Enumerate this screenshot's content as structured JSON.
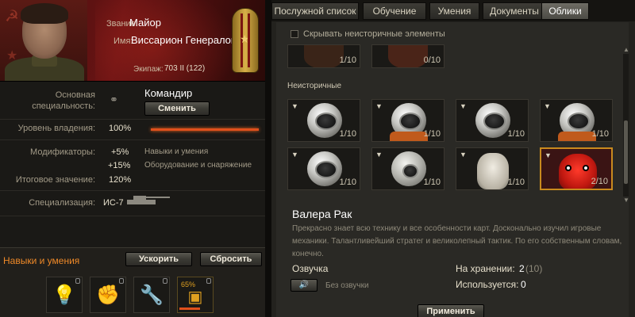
{
  "header": {
    "rank_label": "Звание:",
    "rank": "Майор",
    "name_label": "Имя:",
    "name": "Виссарион Генералов",
    "crew_label": "Экипаж:",
    "crew": "703 II (122)"
  },
  "specialty": {
    "main_label_line1": "Основная",
    "main_label_line2": "специальность:",
    "main_value": "Командир",
    "change_button": "Сменить"
  },
  "stats": {
    "mastery_label": "Уровень владения:",
    "mastery_value": "100%",
    "mastery_fill": 1.0,
    "modifiers_label": "Модификаторы:",
    "modifiers": [
      {
        "value": "+5%",
        "source": "Навыки и умения"
      },
      {
        "value": "+15%",
        "source": "Оборудование и снаряжение"
      }
    ],
    "total_label": "Итоговое значение:",
    "total_value": "120%",
    "specialization_label": "Специализация:",
    "specialization_value": "ИС-7"
  },
  "skills": {
    "title": "Навыки и умения",
    "accelerate_button": "Ускорить",
    "reset_button": "Сбросить",
    "items": [
      {
        "name": "lightbulb-icon",
        "color": "#ff7a20"
      },
      {
        "name": "fist-icon",
        "color": "#d8d2c0"
      },
      {
        "name": "wrench-icon",
        "color": "#c83a2a"
      },
      {
        "name": "skill-in-training-icon",
        "color": "#e0a020",
        "progress_label": "65%",
        "progress": 0.65
      }
    ]
  },
  "tabs": [
    {
      "label": "Послужной список",
      "active": false
    },
    {
      "label": "Обучение",
      "active": false
    },
    {
      "label": "Умения",
      "active": false
    },
    {
      "label": "Документы",
      "active": false
    },
    {
      "label": "Облики",
      "active": true
    }
  ],
  "skins": {
    "hide_nonhistorical_label": "Скрывать неисторичные элементы",
    "hide_nonhistorical_checked": false,
    "top_row_counts": [
      "1/10",
      "0/10"
    ],
    "section_title": "Неисторичные",
    "items": [
      {
        "kind": "astronaut-helmet",
        "count": "1/10"
      },
      {
        "kind": "astronaut-helmet",
        "count": "1/10"
      },
      {
        "kind": "astronaut-helmet",
        "count": "1/10"
      },
      {
        "kind": "astronaut-helmet",
        "count": "1/10"
      },
      {
        "kind": "astronaut-helmet",
        "count": "1/10"
      },
      {
        "kind": "diving-helmet",
        "count": "1/10"
      },
      {
        "kind": "horse-mask",
        "count": "1/10"
      },
      {
        "kind": "crab-costume",
        "count": "2/10",
        "selected": true
      }
    ],
    "selected_name": "Валера Рак",
    "selected_description": "Прекрасно знает всю технику и все особенности карт. Досконально изучил игровые механики. Талантливейший стратег и великолепный тактик. По его собственным словам, конечно.",
    "voice_label": "Озвучка",
    "voice_status": "Без озвучки",
    "storage_label": "На хранении:",
    "storage_value": "2",
    "storage_total": "(10)",
    "used_label": "Используется:",
    "used_value": "0",
    "apply_button": "Применить"
  }
}
